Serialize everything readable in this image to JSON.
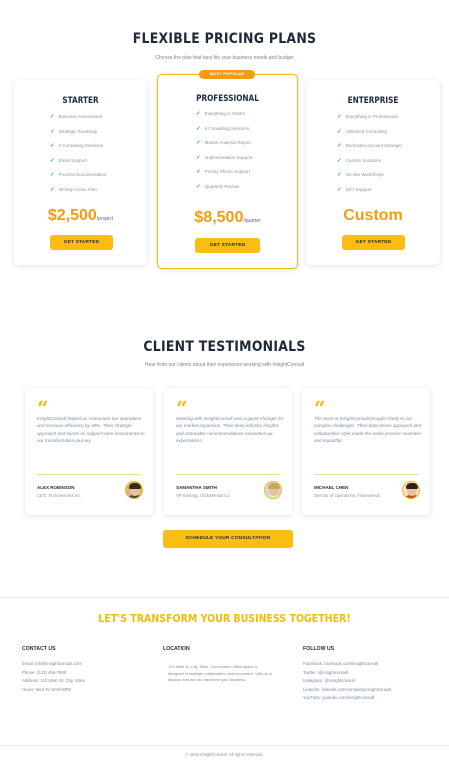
{
  "pricing": {
    "title": "FLEXIBLE PRICING PLANS",
    "subtitle": "Choose the plan that best fits your business needs and budget",
    "badge": "MOST POPULAR",
    "plans": [
      {
        "name": "STARTER",
        "features": [
          "Business Assessment",
          "Strategic Roadmap",
          "2 Consulting Sessions",
          "Email Support",
          "Process Documentation",
          "30-Day Action Plan"
        ],
        "price": "$2,500",
        "period": "/project",
        "button": "GET STARTED"
      },
      {
        "name": "PROFESSIONAL",
        "features": [
          "Everything in Starter",
          "6 Consulting Sessions",
          "Market Analysis Report",
          "Implementation Support",
          "Priority Phone Support",
          "Quarterly Review"
        ],
        "price": "$8,500",
        "period": "/quarter",
        "button": "GET STARTED"
      },
      {
        "name": "ENTERPRISE",
        "features": [
          "Everything in Professional",
          "Unlimited Consulting",
          "Dedicated Account Manager",
          "Custom Solutions",
          "On-site Workshops",
          "24/7 Support"
        ],
        "price": "Custom",
        "period": "",
        "button": "GET STARTED"
      }
    ]
  },
  "testimonials": {
    "title": "CLIENT TESTIMONIALS",
    "subtitle": "Hear from our clients about their experience working with InsightConsult",
    "items": [
      {
        "quote": "InsightConsult helped us restructure our operations and increase efficiency by 40%. Their strategic approach and hands-on support were instrumental in our transformation journey.",
        "name": "ALEX ROBINSON",
        "role": "CEO, TechVentures Inc."
      },
      {
        "quote": "Working with InsightConsult was a game-changer for our market expansion. Their deep industry insights and actionable recommendations exceeded our expectations.",
        "name": "SAMANTHA SMITH",
        "role": "VP Strategy, GlobalRetail Co."
      },
      {
        "quote": "The team at InsightConsult brought clarity to our complex challenges. Their data-driven approach and collaborative style made the entire process seamless and impactful.",
        "name": "MICHAEL CHEN",
        "role": "Director of Operations, FinanceHub"
      }
    ],
    "cta_button": "SCHEDULE YOUR CONSULTATION"
  },
  "contact": {
    "title": "LET'S TRANSFORM YOUR BUSINESS TOGETHER!",
    "columns": [
      {
        "title": "CONTACT US",
        "lines": [
          "Email: info@insightconsult.com",
          "Phone: (123) 456-7890",
          "Address: 123 Main St, City, State",
          "Hours: Mon-Fri 9AM-5PM"
        ]
      },
      {
        "title": "LOCATION",
        "lines": [
          "123 Main St, City, State. Our modern office space is",
          "designed to facilitate collaboration and innovation. Visit us to",
          "discuss how we can transform your business."
        ]
      },
      {
        "title": "FOLLOW US",
        "lines": [
          "Facebook: facebook.com/insightconsult",
          "Twitter: @insightconsult",
          "Instagram: @insightconsult",
          "LinkedIn: linkedin.com/company/insightconsult",
          "YouTube: youtube.com/insightconsult"
        ]
      }
    ]
  },
  "footer": {
    "copyright": "© 2025 InsightConsult. All rights reserved."
  },
  "colors": {
    "accent": "#fbbd12",
    "price": "#f39c12",
    "check": "#2bb673",
    "heading": "#1e2a3a"
  }
}
